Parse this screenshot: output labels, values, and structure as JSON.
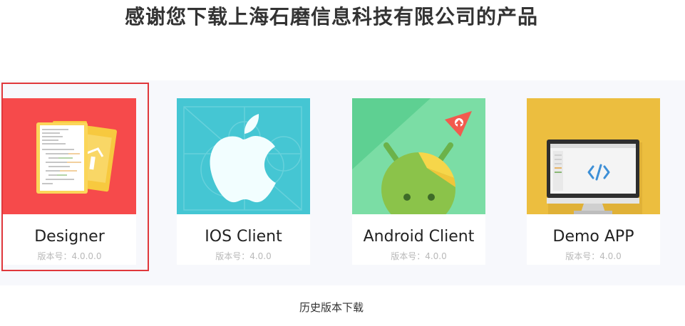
{
  "header": {
    "title": "感谢您下载上海石磨信息科技有限公司的产品"
  },
  "products": [
    {
      "name": "Designer",
      "version": "版本号：4.0.0.0",
      "icon": "designer-code-cards-icon",
      "bg": "#f64a4b"
    },
    {
      "name": "IOS Client",
      "version": "版本号：4.0.0",
      "icon": "apple-icon",
      "bg": "#45c6d3"
    },
    {
      "name": "Android Client",
      "version": "版本号：4.0.0",
      "icon": "android-robot-icon",
      "bg": "#5ed092"
    },
    {
      "name": "Demo APP",
      "version": "版本号：4.0.0",
      "icon": "monitor-code-icon",
      "bg": "#ecbe3f"
    }
  ],
  "footer": {
    "history_link": "历史版本下载"
  },
  "colors": {
    "selected_border": "#e0373b",
    "band_bg": "#f7f8fc"
  }
}
